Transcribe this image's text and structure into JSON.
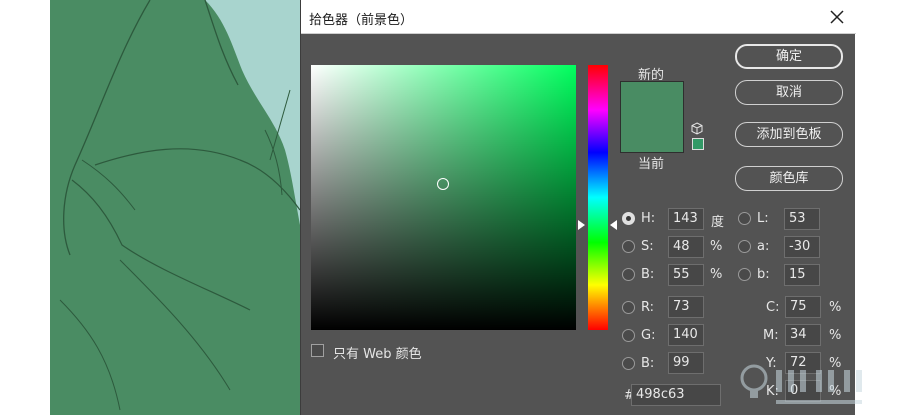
{
  "dialog": {
    "title": "拾色器（前景色）"
  },
  "swatches": {
    "new_label": "新的",
    "current_label": "当前",
    "new_color": "#498c63",
    "current_color": "#498c63"
  },
  "buttons": {
    "ok": "确定",
    "cancel": "取消",
    "add_to_swatches": "添加到色板",
    "color_libraries": "颜色库"
  },
  "hsb": {
    "h_label": "H:",
    "h_value": "143",
    "h_unit": "度",
    "s_label": "S:",
    "s_value": "48",
    "s_unit": "%",
    "b_label": "B:",
    "b_value": "55",
    "b_unit": "%"
  },
  "rgb": {
    "r_label": "R:",
    "r_value": "73",
    "g_label": "G:",
    "g_value": "140",
    "b_label": "B:",
    "b_value": "99"
  },
  "lab": {
    "l_label": "L:",
    "l_value": "53",
    "a_label": "a:",
    "a_value": "-30",
    "b_label": "b:",
    "b_value": "15"
  },
  "cmyk": {
    "c_label": "C:",
    "c_value": "75",
    "m_label": "M:",
    "m_value": "34",
    "y_label": "Y:",
    "y_value": "72",
    "k_label": "K:",
    "k_value": "0",
    "unit": "%"
  },
  "hex": {
    "label": "#",
    "value": "498c63"
  },
  "web_only": {
    "label": "只有 Web 颜色",
    "checked": false
  },
  "colors": {
    "canvas_green": "#498c63",
    "sky": "#a8d4ce",
    "dialog_bg": "#535353"
  }
}
